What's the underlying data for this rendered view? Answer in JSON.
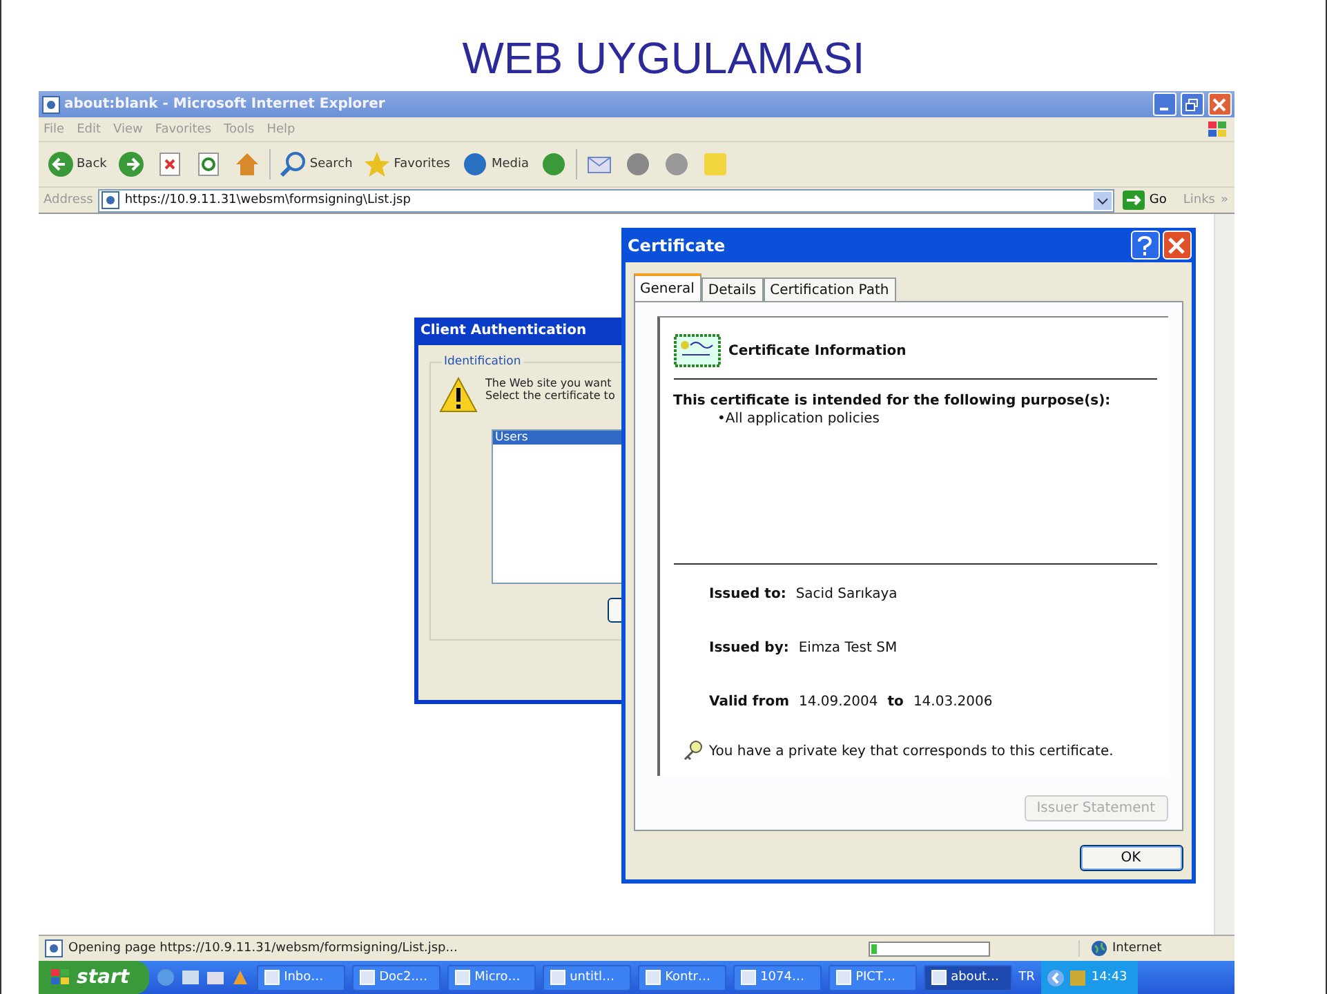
{
  "slide_title": "WEB UYGULAMASI",
  "browser": {
    "title": "about:blank - Microsoft Internet Explorer",
    "menu": [
      "File",
      "Edit",
      "View",
      "Favorites",
      "Tools",
      "Help"
    ],
    "toolbar_groups": [
      [
        {
          "kind": "back",
          "label": "Back"
        },
        {
          "kind": "forward"
        },
        {
          "kind": "stop"
        },
        {
          "kind": "refresh"
        },
        {
          "kind": "home"
        }
      ],
      [
        {
          "kind": "search",
          "label": "Search"
        },
        {
          "kind": "favorites",
          "label": "Favorites"
        },
        {
          "kind": "media",
          "label": "Media"
        },
        {
          "kind": "history"
        }
      ],
      [
        {
          "kind": "mail"
        },
        {
          "kind": "print"
        },
        {
          "kind": "edit"
        },
        {
          "kind": "note"
        }
      ]
    ],
    "address_label": "Address",
    "url": "https://10.9.11.31\\websm\\formsigning\\List.jsp",
    "go": "Go",
    "links": "Links",
    "links_chevron": "»",
    "status": {
      "text": "Opening page https://10.9.11.31/websm/formsigning/List.jsp...",
      "level": 0.05,
      "zone": "Internet"
    }
  },
  "client_auth": {
    "title": "Client Authentication",
    "group": "Identification",
    "lines": [
      "The Web site you want",
      "Select the certificate to"
    ],
    "certificates": [
      {
        "label": "Users",
        "selected": true
      }
    ]
  },
  "certificate": {
    "title": "Certificate",
    "tabs": [
      {
        "label": "General",
        "selected": true
      },
      {
        "label": "Details",
        "selected": false
      },
      {
        "label": "Certification Path",
        "selected": false
      }
    ],
    "heading": "Certificate Information",
    "purpose_heading": "This certificate is intended for the following purpose(s):",
    "purposes": [
      "•All application policies"
    ],
    "issued_to_label": "Issued to:",
    "issued_to": "Sacid Sarıkaya",
    "issued_by_label": "Issued by:",
    "issued_by": "Eimza Test SM",
    "valid_from_label": "Valid from",
    "valid_from": "14.09.2004",
    "valid_to_label": "to",
    "valid_to": "14.03.2006",
    "key_note": "You have a private key that corresponds to this certificate.",
    "issuer_button": {
      "label": "Issuer Statement",
      "disabled": true
    },
    "ok": "OK"
  },
  "taskbar": {
    "start": "start",
    "tasks": [
      {
        "label": "Inbo…",
        "selected": false
      },
      {
        "label": "Doc2.…",
        "selected": false
      },
      {
        "label": "Micro…",
        "selected": false
      },
      {
        "label": "untitl…",
        "selected": false
      },
      {
        "label": "Kontr…",
        "selected": false
      },
      {
        "label": "1074…",
        "selected": false
      },
      {
        "label": "PICT…",
        "selected": false
      },
      {
        "label": "about…",
        "selected": true
      }
    ],
    "language": "TR",
    "clock": "14:43"
  }
}
